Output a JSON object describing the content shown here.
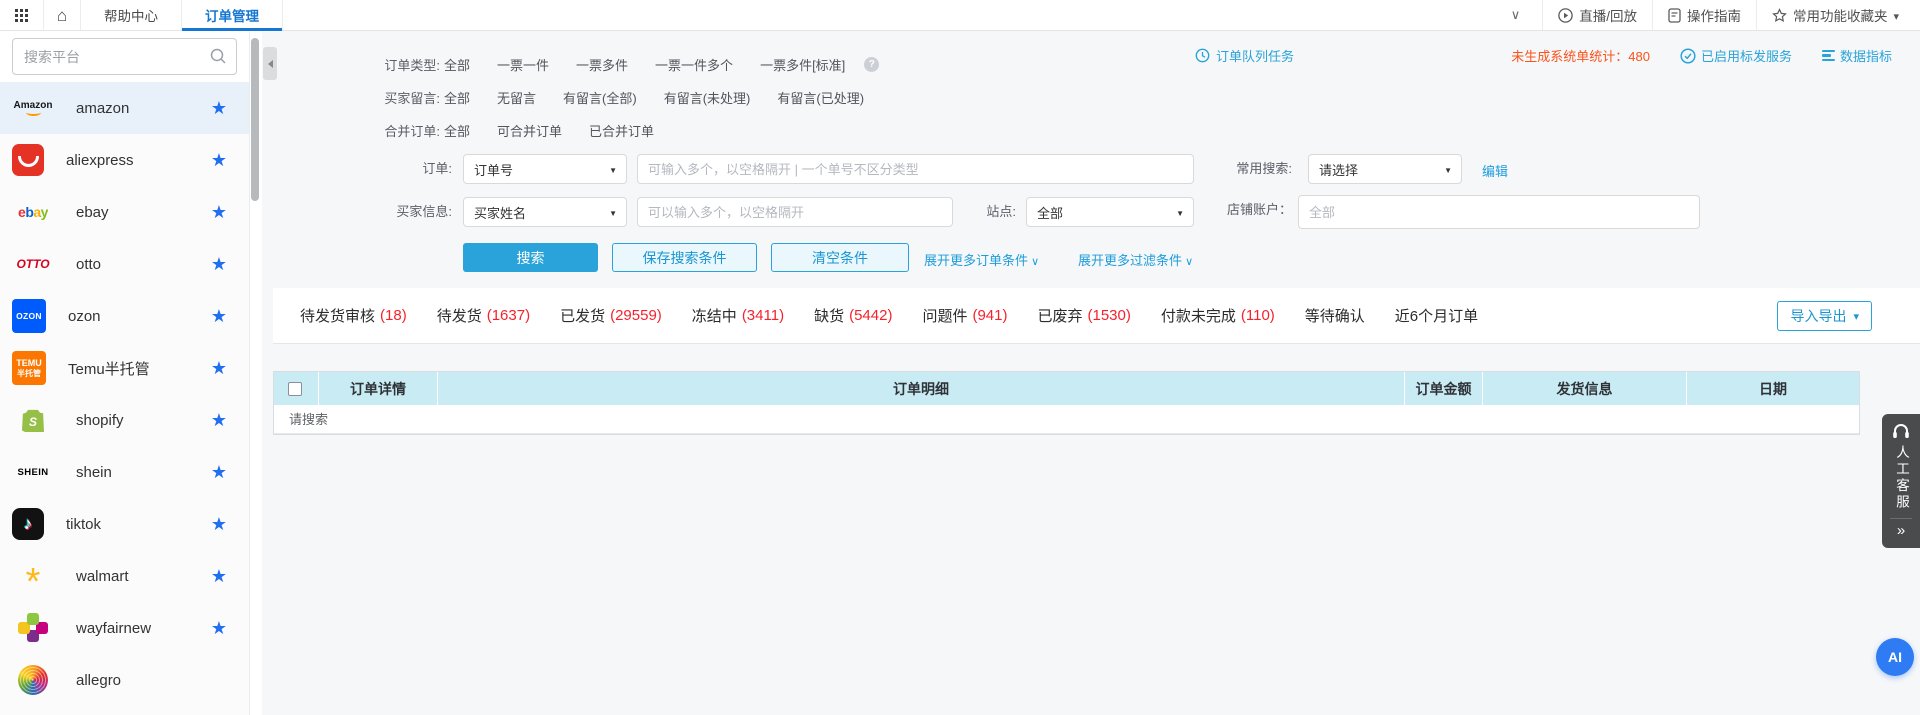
{
  "topnav": {
    "help": "帮助中心",
    "orders": "订单管理",
    "live": "直播/回放",
    "guide": "操作指南",
    "favorites": "常用功能收藏夹"
  },
  "sidebar": {
    "search_placeholder": "搜索平台",
    "platforms": [
      {
        "id": "amazon",
        "label": "amazon",
        "starred": true,
        "active": true
      },
      {
        "id": "aliexpress",
        "label": "aliexpress",
        "starred": true
      },
      {
        "id": "ebay",
        "label": "ebay",
        "starred": true
      },
      {
        "id": "otto",
        "label": "otto",
        "starred": true
      },
      {
        "id": "ozon",
        "label": "ozon",
        "starred": true
      },
      {
        "id": "temu",
        "label": "Temu半托管",
        "starred": true
      },
      {
        "id": "shopify",
        "label": "shopify",
        "starred": true
      },
      {
        "id": "shein",
        "label": "shein",
        "starred": true
      },
      {
        "id": "tiktok",
        "label": "tiktok",
        "starred": true
      },
      {
        "id": "walmart",
        "label": "walmart",
        "starred": true
      },
      {
        "id": "wayfairnew",
        "label": "wayfairnew",
        "starred": true
      },
      {
        "id": "allegro",
        "label": "allegro",
        "starred": false
      }
    ]
  },
  "stats": {
    "queue": "订单队列任务",
    "pending_label": "未生成系统单统计：",
    "pending_value": "480",
    "tag_service": "已启用标发服务",
    "metrics": "数据指标"
  },
  "filters": {
    "order_type": {
      "label": "订单类型:",
      "options": [
        "全部",
        "一票一件",
        "一票多件",
        "一票一件多个",
        "一票多件[标准]"
      ]
    },
    "buyer_message": {
      "label": "买家留言:",
      "options": [
        "全部",
        "无留言",
        "有留言(全部)",
        "有留言(未处理)",
        "有留言(已处理)"
      ]
    },
    "merge": {
      "label": "合并订单:",
      "options": [
        "全部",
        "可合并订单",
        "已合并订单"
      ]
    }
  },
  "form": {
    "order_label": "订单:",
    "order_select": "订单号",
    "order_placeholder": "可输入多个，以空格隔开 | 一个单号不区分类型",
    "quick_label": "常用搜索:",
    "quick_select": "请选择",
    "edit": "编辑",
    "buyer_label": "买家信息:",
    "buyer_select": "买家姓名",
    "buyer_placeholder": "可以输入多个，以空格隔开",
    "site_label": "站点:",
    "site_select": "全部",
    "shop_label": "店铺账户：",
    "shop_placeholder": "全部",
    "search_btn": "搜索",
    "save_btn": "保存搜索条件",
    "clear_btn": "清空条件",
    "more_order": "展开更多订单条件",
    "more_filter": "展开更多过滤条件"
  },
  "tabs": [
    {
      "label": "待发货审核",
      "count": "(18)"
    },
    {
      "label": "待发货",
      "count": "(1637)"
    },
    {
      "label": "已发货",
      "count": "(29559)"
    },
    {
      "label": "冻结中",
      "count": "(3411)"
    },
    {
      "label": "缺货",
      "count": "(5442)"
    },
    {
      "label": "问题件",
      "count": "(941)"
    },
    {
      "label": "已废弃",
      "count": "(1530)"
    },
    {
      "label": "付款未完成",
      "count": "(110)"
    },
    {
      "label": "等待确认",
      "count": null
    },
    {
      "label": "近6个月订单",
      "count": null
    }
  ],
  "import_export": "导入导出",
  "table": {
    "headers": [
      "订单详情",
      "订单明细",
      "订单金额",
      "发货信息",
      "日期"
    ],
    "empty": "请搜索"
  },
  "widgets": {
    "support": "人工客服",
    "ai": "AI"
  },
  "colors": {
    "accent_blue": "#29a3d9",
    "tab_active_blue": "#1677d2",
    "link_blue": "#1e9ddb",
    "count_red": "#f5222d",
    "stat_orange": "#fa541c",
    "table_header_bg": "#c9ebf4",
    "favorite_star_blue": "#1f6ff0",
    "support_tab_bg": "#4a4b4d",
    "ai_button_bg": "#2e7bf3"
  },
  "icons": [
    "apps-grid-icon",
    "home-icon",
    "search-icon",
    "favorite-star-icon",
    "chevron-down-icon",
    "play-circle-icon",
    "guide-doc-icon",
    "star-outline-icon",
    "caret-down-icon",
    "clock-icon",
    "check-circle-icon",
    "metrics-bars-icon",
    "help-icon",
    "collapse-left-icon",
    "headset-icon",
    "double-arrow-icon"
  ]
}
